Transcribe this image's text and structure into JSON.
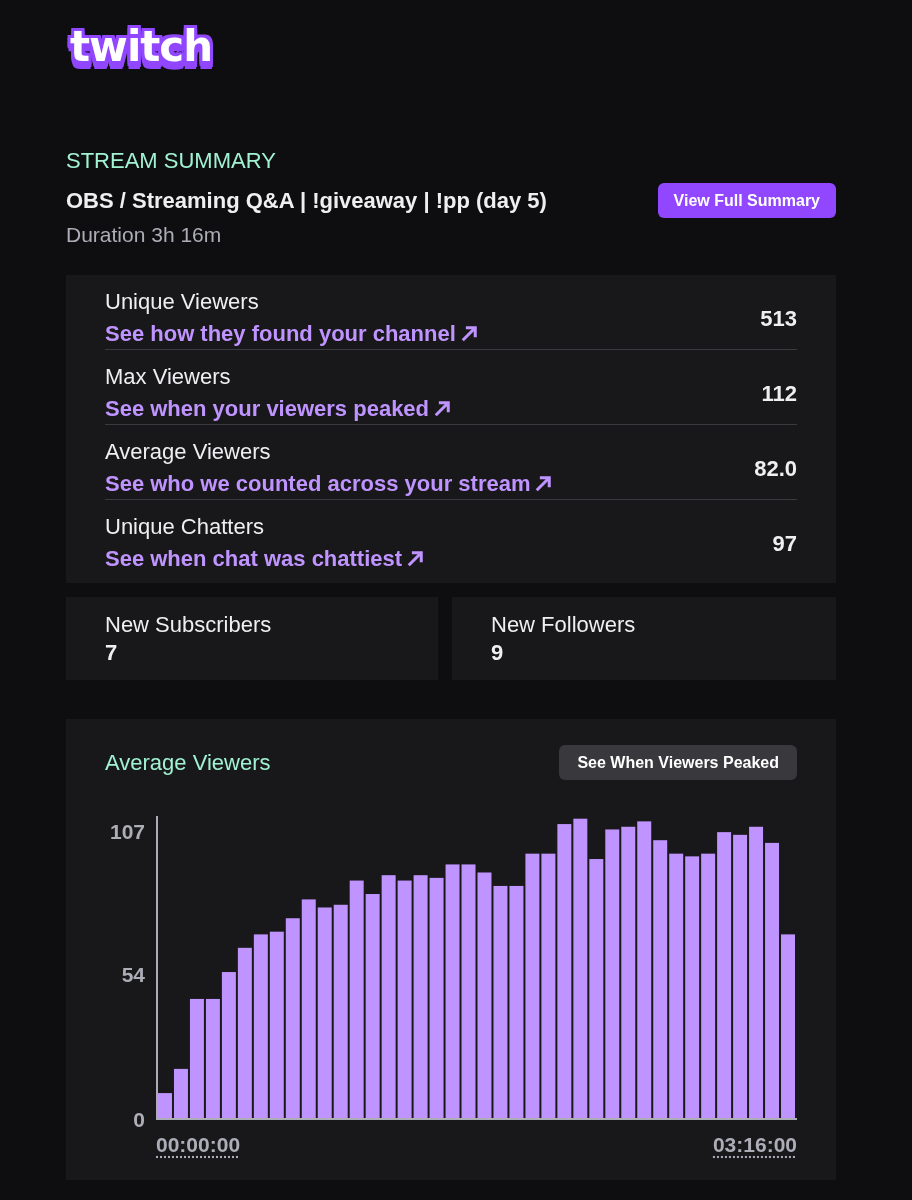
{
  "logo": {
    "text": "twitch"
  },
  "summary": {
    "heading": "STREAM SUMMARY",
    "title": "OBS / Streaming Q&A | !giveaway | !pp (day 5)",
    "duration": "Duration 3h 16m",
    "button": "View Full Summary"
  },
  "stats": [
    {
      "label": "Unique Viewers",
      "link": "See how they found your channel",
      "value": "513"
    },
    {
      "label": "Max Viewers",
      "link": "See when your viewers peaked",
      "value": "112"
    },
    {
      "label": "Average Viewers",
      "link": "See who we counted across your stream",
      "value": "82.0"
    },
    {
      "label": "Unique Chatters",
      "link": "See when chat was chattiest",
      "value": "97"
    }
  ],
  "counters": [
    {
      "label": "New Subscribers",
      "value": "7"
    },
    {
      "label": "New Followers",
      "value": "9"
    }
  ],
  "chart_panel": {
    "title": "Average Viewers",
    "button": "See When Viewers Peaked",
    "time_labels": [
      "00:00:00",
      "03:16:00"
    ],
    "chart_data": {
      "type": "bar",
      "values": [
        10,
        19,
        45,
        45,
        55,
        64,
        69,
        70,
        75,
        82,
        79,
        80,
        89,
        84,
        91,
        89,
        91,
        90,
        95,
        95,
        92,
        87,
        87,
        99,
        99,
        110,
        112,
        97,
        108,
        109,
        111,
        104,
        99,
        98,
        99,
        107,
        106,
        109,
        103,
        69
      ],
      "ylim": [
        0,
        113
      ],
      "yticks": [
        0,
        54,
        107
      ]
    }
  }
}
